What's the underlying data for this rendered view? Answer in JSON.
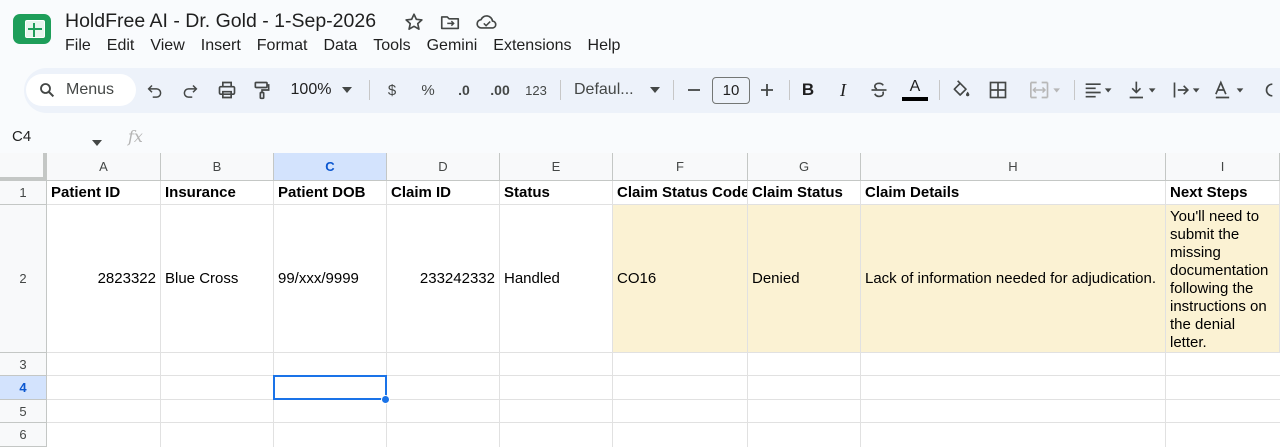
{
  "app": {
    "doc_title": "HoldFree AI - Dr. Gold - 1-Sep-2026",
    "title_icons": [
      "star-icon",
      "move-to-folder-icon",
      "cloud-saved-icon"
    ]
  },
  "menubar": {
    "items": [
      "File",
      "Edit",
      "View",
      "Insert",
      "Format",
      "Data",
      "Tools",
      "Gemini",
      "Extensions",
      "Help"
    ]
  },
  "toolbar": {
    "menus_label": "Menus",
    "zoom": "100%",
    "currency": "$",
    "percent": "%",
    "decrease_decimals": ".0",
    "increase_decimals": ".00",
    "number_format": "123",
    "font": "Defaul...",
    "font_size": "10",
    "bold": "B",
    "italic": "I",
    "text_color_glyph": "A",
    "colors": {
      "accent": "#1a73e8",
      "logo": "#1e9e5a",
      "highlight": "#fbf2d3"
    }
  },
  "formula_bar": {
    "cell_ref": "C4",
    "fx": "fx",
    "value": ""
  },
  "sheet": {
    "columns": [
      "A",
      "B",
      "C",
      "D",
      "E",
      "F",
      "G",
      "H",
      "I"
    ],
    "rows": [
      "1",
      "2",
      "3",
      "4",
      "5",
      "6"
    ],
    "selected_cell": "C4",
    "headers": [
      "Patient ID",
      "Insurance",
      "Patient DOB",
      "Claim ID",
      "Status",
      "Claim Status Code",
      "Claim Status",
      "Claim Details",
      "Next Steps"
    ],
    "data": [
      {
        "patient_id": "2823322",
        "insurance": "Blue Cross",
        "patient_dob": "99/xxx/9999",
        "claim_id": "233242332",
        "status": "Handled",
        "claim_status_code": "CO16",
        "claim_status": "Denied",
        "claim_details": "Lack of information needed for adjudication.",
        "next_steps": "You'll need to submit the missing documentation following the instructions on the denial letter."
      }
    ]
  }
}
